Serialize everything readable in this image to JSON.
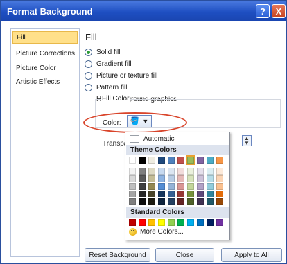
{
  "window": {
    "title": "Format Background",
    "help_label": "?",
    "close_label": "X"
  },
  "nav": {
    "items": [
      {
        "label": "Fill",
        "active": true
      },
      {
        "label": "Picture Corrections",
        "active": false
      },
      {
        "label": "Picture Color",
        "active": false
      },
      {
        "label": "Artistic Effects",
        "active": false
      }
    ]
  },
  "fill": {
    "heading": "Fill",
    "options": [
      "Solid fill",
      "Gradient fill",
      "Picture or texture fill",
      "Pattern fill"
    ],
    "selected_option": "Solid fill",
    "hide_graphics_label": "Hide background graphics",
    "fill_color_label": "Fill Color",
    "color_label": "Color:",
    "transparency_label": "Transpa",
    "bucket_icon": "paint-bucket-icon"
  },
  "dropdown": {
    "automatic_label": "Automatic",
    "theme_header": "Theme Colors",
    "standard_header": "Standard Colors",
    "more_label": "More Colors...",
    "theme_top": [
      "#ffffff",
      "#000000",
      "#eeece1",
      "#1f497d",
      "#4f81bd",
      "#c0504d",
      "#9bbb59",
      "#8064a2",
      "#4bacc6",
      "#f79646"
    ],
    "theme_shades": [
      [
        "#f2f2f2",
        "#7f7f7f",
        "#ddd9c3",
        "#c6d9f0",
        "#dbe5f1",
        "#f2dcdb",
        "#ebf1dd",
        "#e5e0ec",
        "#dbeef3",
        "#fdeada"
      ],
      [
        "#d8d8d8",
        "#595959",
        "#c4bd97",
        "#8db3e2",
        "#b8cce4",
        "#e5b9b7",
        "#d7e3bc",
        "#ccc1d9",
        "#b7dde8",
        "#fbd5b5"
      ],
      [
        "#bfbfbf",
        "#3f3f3f",
        "#938953",
        "#548dd4",
        "#95b3d7",
        "#d99694",
        "#c3d69b",
        "#b2a2c7",
        "#92cddc",
        "#fac08f"
      ],
      [
        "#a5a5a5",
        "#262626",
        "#494429",
        "#17365d",
        "#366092",
        "#953734",
        "#76923c",
        "#5f497a",
        "#31859b",
        "#e36c09"
      ],
      [
        "#7f7f7f",
        "#0c0c0c",
        "#1d1b10",
        "#0f243e",
        "#244061",
        "#632423",
        "#4f6128",
        "#3f3151",
        "#205867",
        "#974806"
      ]
    ],
    "standard": [
      "#c00000",
      "#ff0000",
      "#ffc000",
      "#ffff00",
      "#92d050",
      "#00b050",
      "#00b0f0",
      "#0070c0",
      "#002060",
      "#7030a0"
    ],
    "selected_theme_index": 6
  },
  "buttons": {
    "reset_label": "Reset Background",
    "close_label": "Close",
    "apply_label": "Apply to All"
  },
  "colors": {
    "title_bar": "#1e4fc2",
    "highlight": "#ffe08a",
    "annotation": "#d9442a"
  }
}
